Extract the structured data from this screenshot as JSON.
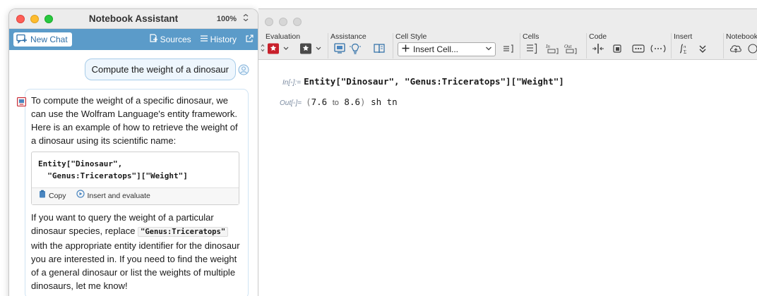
{
  "assistant": {
    "title": "Notebook Assistant",
    "zoom": "100%",
    "toolbar": {
      "new_chat": "New Chat",
      "sources": "Sources",
      "history": "History"
    },
    "user_message": "Compute the weight of a dinosaur",
    "reply": {
      "intro": "To compute the weight of a specific dinosaur, we can use the Wolfram Language's entity framework. Here is an example of how to retrieve the weight of a dinosaur using its scientific name:",
      "code_line1": "Entity[\"Dinosaur\",",
      "code_line2": "  \"Genus:Triceratops\"][\"Weight\"]",
      "copy_label": "Copy",
      "insert_eval_label": "Insert and evaluate",
      "para2_before": "If you want to query the weight of a particular dinosaur species, replace ",
      "para2_code": "\"Genus:Triceratops\"",
      "para2_after": " with the appropriate entity identifier for the dinosaur you are interested in. If you need to find the weight of a general dinosaur or list the weights of multiple dinosaurs, let me know!"
    }
  },
  "notebook": {
    "toolbar_groups": {
      "evaluation": "Evaluation",
      "assistance": "Assistance",
      "cell_style": "Cell Style",
      "cells": "Cells",
      "code": "Code",
      "insert": "Insert",
      "notebook": "Notebook"
    },
    "insert_cell_label": "Insert Cell...",
    "input_label": "In[◦]:=",
    "input_code_head": "Entity",
    "input_code_rest": "[\"Dinosaur\", \"Genus:Triceratops\"][\"Weight\"]",
    "output_label": "Out[◦]=",
    "output": {
      "low": "7.6",
      "to_word": "to",
      "high": "8.6",
      "unit": "sh tn"
    }
  },
  "colors": {
    "toolbar_blue": "#5b9bc9",
    "eval_red": "#c8202b",
    "accent_link": "#2f6fa7"
  }
}
